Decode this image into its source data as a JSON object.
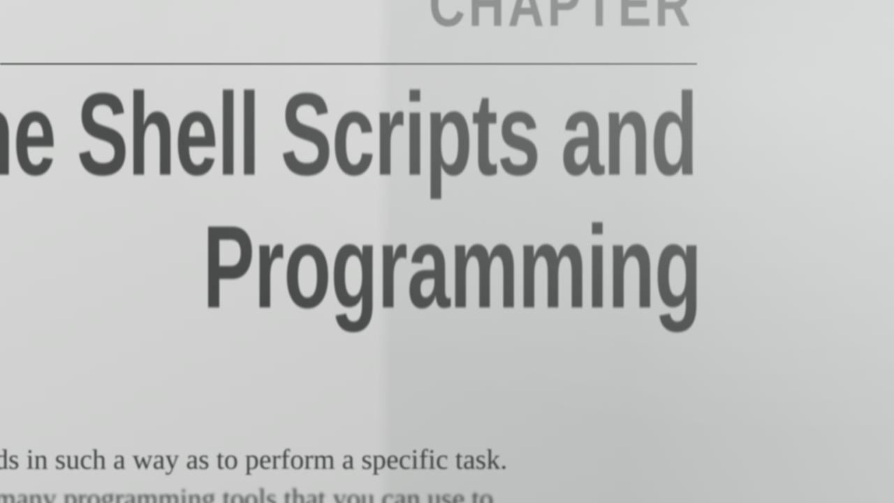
{
  "page": {
    "chapter_label": "CHAPTER",
    "title_line_1": "The Shell Scripts and",
    "title_line_2": "Programming",
    "body_line_1": "ds in such a way as to perform a specific task.",
    "body_line_2": "many programming tools that you can use to"
  },
  "colors": {
    "paper": "#d2d3d2",
    "title_ink": "#464848",
    "body_ink": "#3f4242",
    "rule": "#6f7171"
  }
}
